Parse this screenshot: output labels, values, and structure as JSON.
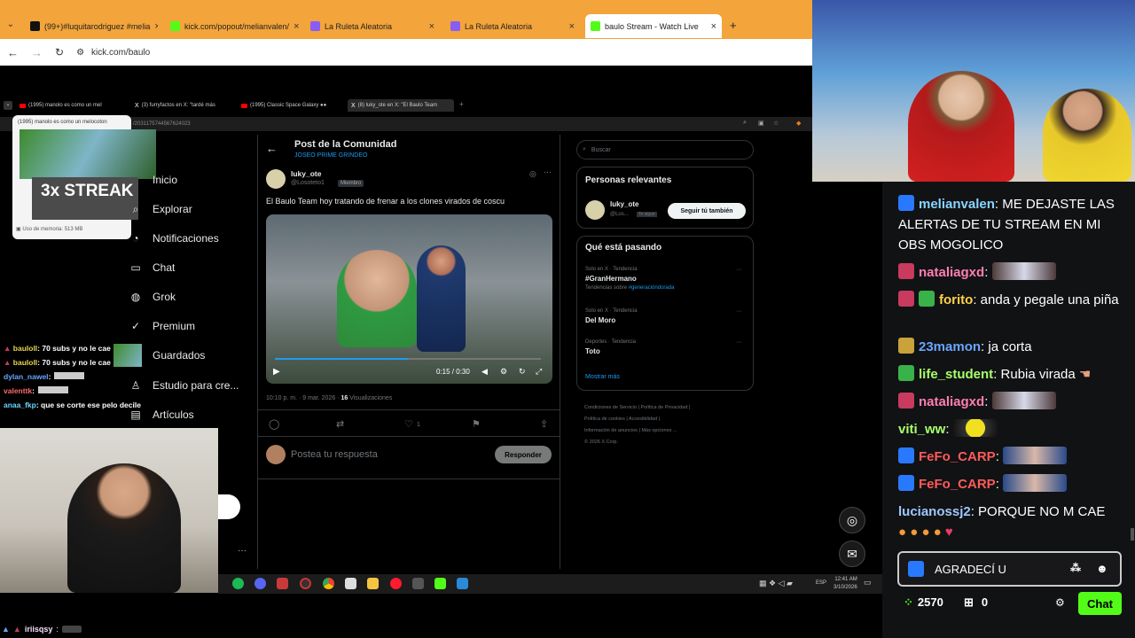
{
  "outer_browser": {
    "tabs": [
      {
        "label": "(99+)#luquitarodriguez #melia",
        "color": "#111"
      },
      {
        "label": "kick.com/popout/melianvalen/",
        "color": "#53fc18"
      },
      {
        "label": "La Ruleta Aleatoria",
        "color": "#8a5cf6"
      },
      {
        "label": "La Ruleta Aleatoria",
        "color": "#8a5cf6"
      },
      {
        "label": "baulo Stream - Watch Live",
        "color": "#53fc18"
      }
    ],
    "url": "kick.com/baulo"
  },
  "inner_browser": {
    "tabs": [
      "(1995) manolo es como un mel",
      "(3) furryfactos en X: \"tardé más",
      "(1995) Classic Space Galaxy ●●",
      "(8) luky_ote en X: \"El Baulo Team"
    ],
    "overlay_text": "(1995) manolo es como un melocoton",
    "streak_text": "3x STREAK",
    "memory_text": "Uso de memoria: 513 MB",
    "url_suffix": "/2031175744567624023"
  },
  "x_nav": [
    {
      "label": "Inicio",
      "icon": "home-icon",
      "glyph": "⌂"
    },
    {
      "label": "Explorar",
      "icon": "search-icon",
      "glyph": "⌕"
    },
    {
      "label": "Notificaciones",
      "icon": "bell-icon",
      "glyph": "◔"
    },
    {
      "label": "Chat",
      "icon": "chat-icon",
      "glyph": "▭"
    },
    {
      "label": "Grok",
      "icon": "grok-icon",
      "glyph": "◍"
    },
    {
      "label": "Premium",
      "icon": "premium-icon",
      "glyph": "✓"
    },
    {
      "label": "Guardados",
      "icon": "bookmark-icon",
      "glyph": "⚑"
    },
    {
      "label": "Estudio para cre...",
      "icon": "studio-icon",
      "glyph": "♙"
    },
    {
      "label": "Artículos",
      "icon": "articles-icon",
      "glyph": "▤"
    }
  ],
  "post": {
    "header_title": "Post de la Comunidad",
    "community": "JOSEO PRIME GRINDEO",
    "author": "luky_ote",
    "handle": "@Losoteto1",
    "member_badge": "Miembro",
    "text": "El Baulo Team hoy tratando de frenar a los clones virados de coscu",
    "video_time": "0:15 / 0:30",
    "meta_time": "10:10 p. m. · 9 mar. 2026 ·",
    "views_count": "16",
    "views_label": "Visualizaciones",
    "like_count": "1",
    "reply_placeholder": "Postea tu respuesta",
    "reply_button": "Responder"
  },
  "right_panel": {
    "search_placeholder": "Buscar",
    "relevant_title": "Personas relevantes",
    "relevant_name": "luky_ote",
    "relevant_handle": "@Los...",
    "follows_you": "Te sigue",
    "follow_back": "Seguir tú también",
    "trending_title": "Qué está pasando",
    "trends": [
      {
        "context": "Solo en X · Tendencia",
        "name": "#GranHermano",
        "extra": "Tendencias sobre",
        "link": "#generacióndorada"
      },
      {
        "context": "Solo en X · Tendencia",
        "name": "Del Moro",
        "extra": "",
        "link": ""
      },
      {
        "context": "Deportes · Tendencia",
        "name": "Toto",
        "extra": "",
        "link": ""
      }
    ],
    "show_more": "Mostrar más",
    "footer": [
      "Condiciones de Servicio",
      "Política de Privacidad",
      "Política de cookies",
      "Accesibilidad",
      "Información de anuncios",
      "Más opciones ...",
      "© 2026 X Corp."
    ]
  },
  "left_chat": [
    {
      "user": "bauloll",
      "text": ": 70 subs y no le cae",
      "color": "#e8d44d"
    },
    {
      "user": "bauloll",
      "text": ": 70 subs y no le cae",
      "color": "#e8d44d"
    },
    {
      "user": "dylan_nawel",
      "text": ":",
      "color": "#6aa6ff"
    },
    {
      "user": "valenttk",
      "text": ":",
      "color": "#ff6a6a"
    },
    {
      "user": "anaa_fkp",
      "text": ": que se corte ese pelo decile",
      "color": "#6ad7ff"
    }
  ],
  "bottom_bar": {
    "user": "iriisqsy",
    "text": ":"
  },
  "taskbar": {
    "time": "12:41 AM",
    "date": "3/10/2026",
    "lang": "ESP"
  },
  "chat": {
    "messages": [
      {
        "user": "melianvalen",
        "color": "#8ad4ff",
        "badge": "#2979ff",
        "text": ": ME DEJASTE LAS ALERTAS DE TU STREAM EN MI OBS MOGOLICO"
      },
      {
        "user": "nataliagxd",
        "color": "#ff7eb3",
        "badge": "#c83a5e",
        "text": ":"
      },
      {
        "user": "forito",
        "color": "#ffd24a",
        "badge": "#c83a5e",
        "text": ": anda y pegale una piña"
      },
      {
        "user": "23mamon",
        "color": "#6aa6ff",
        "badge": "#c8a23a",
        "text": ": ja corta"
      },
      {
        "user": "life_student",
        "color": "#a8ff6a",
        "badge": "#3ab24a",
        "text": ": Rubia virada"
      },
      {
        "user": "nataliagxd",
        "color": "#ff7eb3",
        "badge": "#c83a5e",
        "text": ":"
      },
      {
        "user": "viti_ww",
        "color": "#a8ff6a",
        "badge": "",
        "text": ":"
      },
      {
        "user": "FeFo_CARP",
        "color": "#ff5a5a",
        "badge": "#2979ff",
        "text": ":"
      },
      {
        "user": "FeFo_CARP",
        "color": "#ff5a5a",
        "badge": "#2979ff",
        "text": ":"
      },
      {
        "user": "lucianossj2",
        "color": "#9ec8ff",
        "badge": "",
        "text": ": PORQUE NO M CAE"
      }
    ],
    "input_value": "AGRADECÍ U",
    "points": "2570",
    "gifts": "0",
    "send_label": "Chat"
  }
}
